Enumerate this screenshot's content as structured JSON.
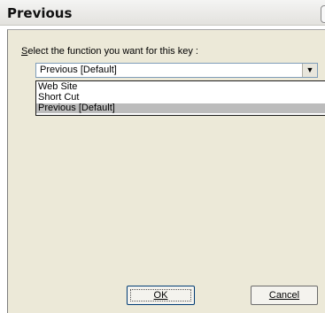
{
  "window": {
    "title": "Previous"
  },
  "dialog": {
    "prompt_first": "S",
    "prompt_rest": "elect the function you want for this key :",
    "select_value": "Previous [Default]",
    "options": [
      {
        "label": "Web Site",
        "selected": false
      },
      {
        "label": "Short Cut",
        "selected": false
      },
      {
        "label": "Previous [Default]",
        "selected": true
      }
    ],
    "ok_label": "OK",
    "cancel_label": "Cancel"
  },
  "icons": {
    "dropdown": "chevron-down-icon"
  }
}
